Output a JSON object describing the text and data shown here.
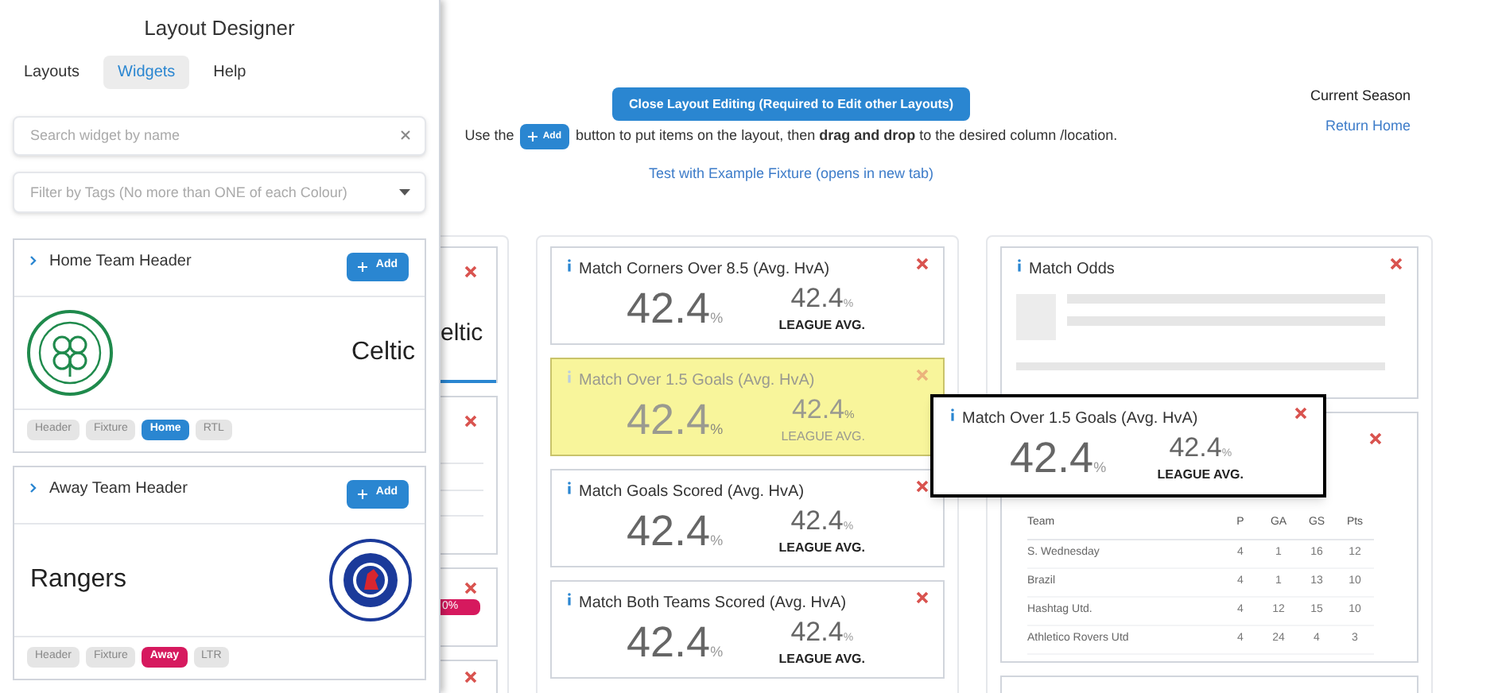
{
  "sidebar": {
    "title": "Layout Designer",
    "tabs": [
      {
        "label": "Layouts",
        "selected": false
      },
      {
        "label": "Widgets",
        "selected": true
      },
      {
        "label": "Help",
        "selected": false
      }
    ],
    "search": {
      "placeholder": "Search widget by name"
    },
    "filter": {
      "placeholder": "Filter by Tags (No more than ONE of each Colour)"
    },
    "widgets": [
      {
        "kind": "home",
        "title": "Home Team Header",
        "add_label": "Add",
        "team": "Celtic",
        "tags": [
          {
            "label": "Header",
            "color": "#e5e5e5"
          },
          {
            "label": "Fixture",
            "color": "#e5e5e5"
          },
          {
            "label": "Home",
            "color": "#2a86d1"
          },
          {
            "label": "RTL",
            "color": "#e5e5e5"
          }
        ]
      },
      {
        "kind": "away",
        "title": "Away Team Header",
        "add_label": "Add",
        "team": "Rangers",
        "tags": [
          {
            "label": "Header",
            "color": "#e5e5e5"
          },
          {
            "label": "Fixture",
            "color": "#e5e5e5"
          },
          {
            "label": "Away",
            "color": "#d6195e"
          },
          {
            "label": "LTR",
            "color": "#e5e5e5"
          }
        ]
      }
    ]
  },
  "header": {
    "close_button": "Close Layout Editing (Required to Edit other Layouts)",
    "instruction_before": "Use the",
    "instruction_button": "Add",
    "instruction_after": "button to put items on the layout, then **drag and drop** to the desired column /location.",
    "test_link": "Test with Example Fixture (opens in new tab)",
    "season": "Current Season",
    "return_link": "Return Home"
  },
  "columns": [
    {
      "cards": [
        {
          "kind": "team",
          "text": "eltic"
        },
        {
          "kind": "list"
        },
        {
          "kind": "bar",
          "text": "0%"
        },
        {
          "kind": "plain"
        }
      ]
    },
    {
      "cards": [
        {
          "kind": "stat",
          "ghost": false,
          "title": "Match Corners Over 8.5 (Avg. HvA)",
          "value": "42.4",
          "unit": "%",
          "league_value": "42.4",
          "league_unit": "%",
          "league_label": "LEAGUE AVG."
        },
        {
          "kind": "stat",
          "ghost": true,
          "title": "Match Over 1.5 Goals (Avg. HvA)",
          "value": "42.4",
          "unit": "%",
          "league_value": "42.4",
          "league_unit": "%",
          "league_label": "LEAGUE AVG."
        },
        {
          "kind": "stat",
          "ghost": false,
          "title": "Match Goals Scored (Avg. HvA)",
          "value": "42.4",
          "unit": "%",
          "league_value": "42.4",
          "league_unit": "%",
          "league_label": "LEAGUE AVG."
        },
        {
          "kind": "stat",
          "ghost": false,
          "title": "Match Both Teams Scored (Avg. HvA)",
          "value": "42.4",
          "unit": "%",
          "league_value": "42.4",
          "league_unit": "%",
          "league_label": "LEAGUE AVG."
        }
      ]
    },
    {
      "cards": [
        {
          "kind": "odds",
          "title": "Match Odds"
        },
        {
          "kind": "table",
          "columns": [
            "Team",
            "P",
            "GA",
            "GS",
            "Pts"
          ],
          "rows": [
            [
              "S. Wednesday",
              "4",
              "1",
              "16",
              "12"
            ],
            [
              "Brazil",
              "4",
              "1",
              "13",
              "10"
            ],
            [
              "Hashtag Utd.",
              "4",
              "12",
              "15",
              "10"
            ],
            [
              "Athletico Rovers Utd",
              "4",
              "24",
              "4",
              "3"
            ]
          ]
        },
        {
          "kind": "plain"
        }
      ]
    }
  ],
  "drag_preview": {
    "title": "Match Over 1.5 Goals (Avg. HvA)",
    "value": "42.4",
    "unit": "%",
    "league_value": "42.4",
    "league_unit": "%",
    "league_label": "LEAGUE AVG."
  }
}
